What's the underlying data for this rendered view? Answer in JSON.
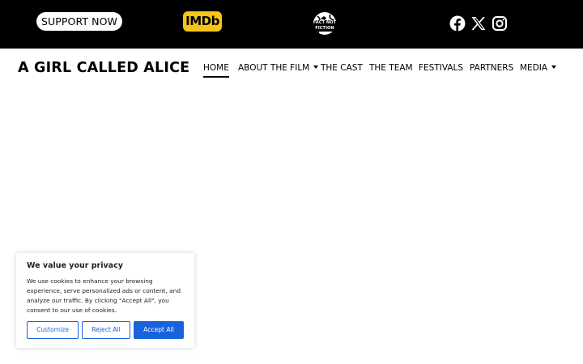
{
  "topbar": {
    "support_label": "SUPPORT NOW",
    "imdb_label": "IMDb",
    "fnf_label": "FACT NOT FICTION",
    "social": [
      "facebook-icon",
      "x-icon",
      "instagram-icon"
    ],
    "colors": {
      "bar": "#000000",
      "imdb": "#f5c518"
    }
  },
  "header": {
    "site_title": "A GIRL CALLED ALICE",
    "nav": {
      "home": "HOME",
      "about": "ABOUT THE FILM",
      "cast": "THE CAST",
      "team": "THE TEAM",
      "festivals": "FESTIVALS",
      "partners": "PARTNERS",
      "media": "MEDIA"
    }
  },
  "cookie": {
    "title": "We value your privacy",
    "text": "We use cookies to enhance your browsing experience, serve personalized ads or content, and analyze our traffic. By clicking \"Accept All\", you consent to our use of cookies.",
    "customize": "Customize",
    "reject": "Reject All",
    "accept": "Accept All",
    "accent": "#1863dc"
  }
}
